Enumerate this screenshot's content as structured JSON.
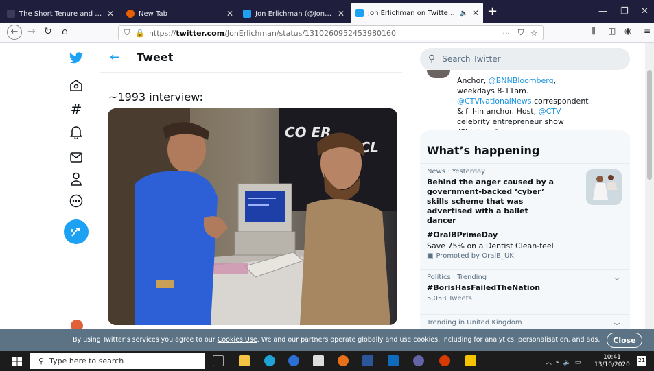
{
  "browser": {
    "tabs": [
      {
        "title": "The Short Tenure and Abrupt O",
        "active": false
      },
      {
        "title": "New Tab",
        "active": false
      },
      {
        "title": "Jon Erlichman (@JonErlichman)",
        "active": false
      },
      {
        "title": "Jon Erlichman on Twitter: \"",
        "active": true
      }
    ],
    "url_prefix": "https://",
    "url_domain": "twitter.com",
    "url_path": "/JonErlichman/status/1310260952453980160",
    "url_more": "···"
  },
  "main": {
    "title": "Tweet",
    "tweet_text": "~1993 interview:"
  },
  "media": {
    "screen_text_1": "CO    ER",
    "screen_text_2": "ICL"
  },
  "sidebar": {
    "search_placeholder": "Search Twitter",
    "bio_line1": "Anchor, ",
    "bio_link1": "@BNNBloomberg",
    "bio_line1b": ", weekdays 8-11am. ",
    "bio_link2": "@CTVNationalNews",
    "bio_line2": " correspondent & fill-in anchor. Host, ",
    "bio_link3": "@CTV",
    "bio_line3": " celebrity entrepreneur show \"Sidelines\"",
    "trends_title": "What’s happening",
    "trends": [
      {
        "meta": "News · Yesterday",
        "name": "Behind the anger caused by a government-backed ‘cyber’ skills scheme that was advertised with a ballet dancer"
      },
      {
        "name": "#OralBPrimeDay",
        "sub": "Save 75% on a Dentist Clean-feel",
        "promo": "Promoted by OralB_UK"
      },
      {
        "meta": "Politics · Trending",
        "name": "#BorisHasFailedTheNation",
        "count": "5,053 Tweets"
      },
      {
        "meta": "Trending in United Kingdom"
      }
    ]
  },
  "cookie": {
    "text_before": "By using Twitter’s services you agree to our ",
    "link": "Cookies Use",
    "text_after": ". We and our partners operate globally and use cookies, including for analytics, personalisation, and ads.",
    "close_label": "Close"
  },
  "taskbar": {
    "search_placeholder": "Type here to search",
    "time": "10:41",
    "date": "13/10/2020",
    "notif_count": "21"
  },
  "colors": {
    "twitter_blue": "#1da1f2",
    "tab_strip": "#1f1f3d",
    "cookie_banner": "#5b7384"
  }
}
